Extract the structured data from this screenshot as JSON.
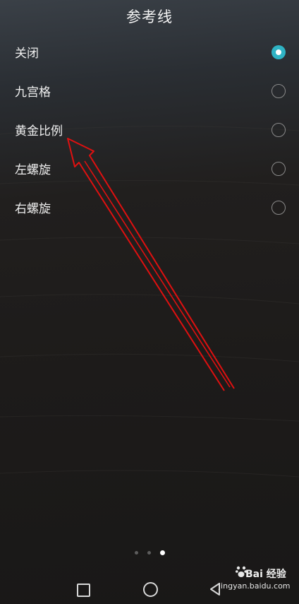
{
  "header": {
    "title": "参考线"
  },
  "options": [
    {
      "label": "关闭",
      "selected": true
    },
    {
      "label": "九宫格",
      "selected": false
    },
    {
      "label": "黄金比例",
      "selected": false
    },
    {
      "label": "左螺旋",
      "selected": false
    },
    {
      "label": "右螺旋",
      "selected": false
    }
  ],
  "pager": {
    "count": 3,
    "active_index": 2
  },
  "watermark": {
    "brand": "Bai 经验",
    "url": "jingyan.baidu.com"
  },
  "colors": {
    "accent": "#2fb3c4",
    "annotation_arrow": "#e01010"
  }
}
